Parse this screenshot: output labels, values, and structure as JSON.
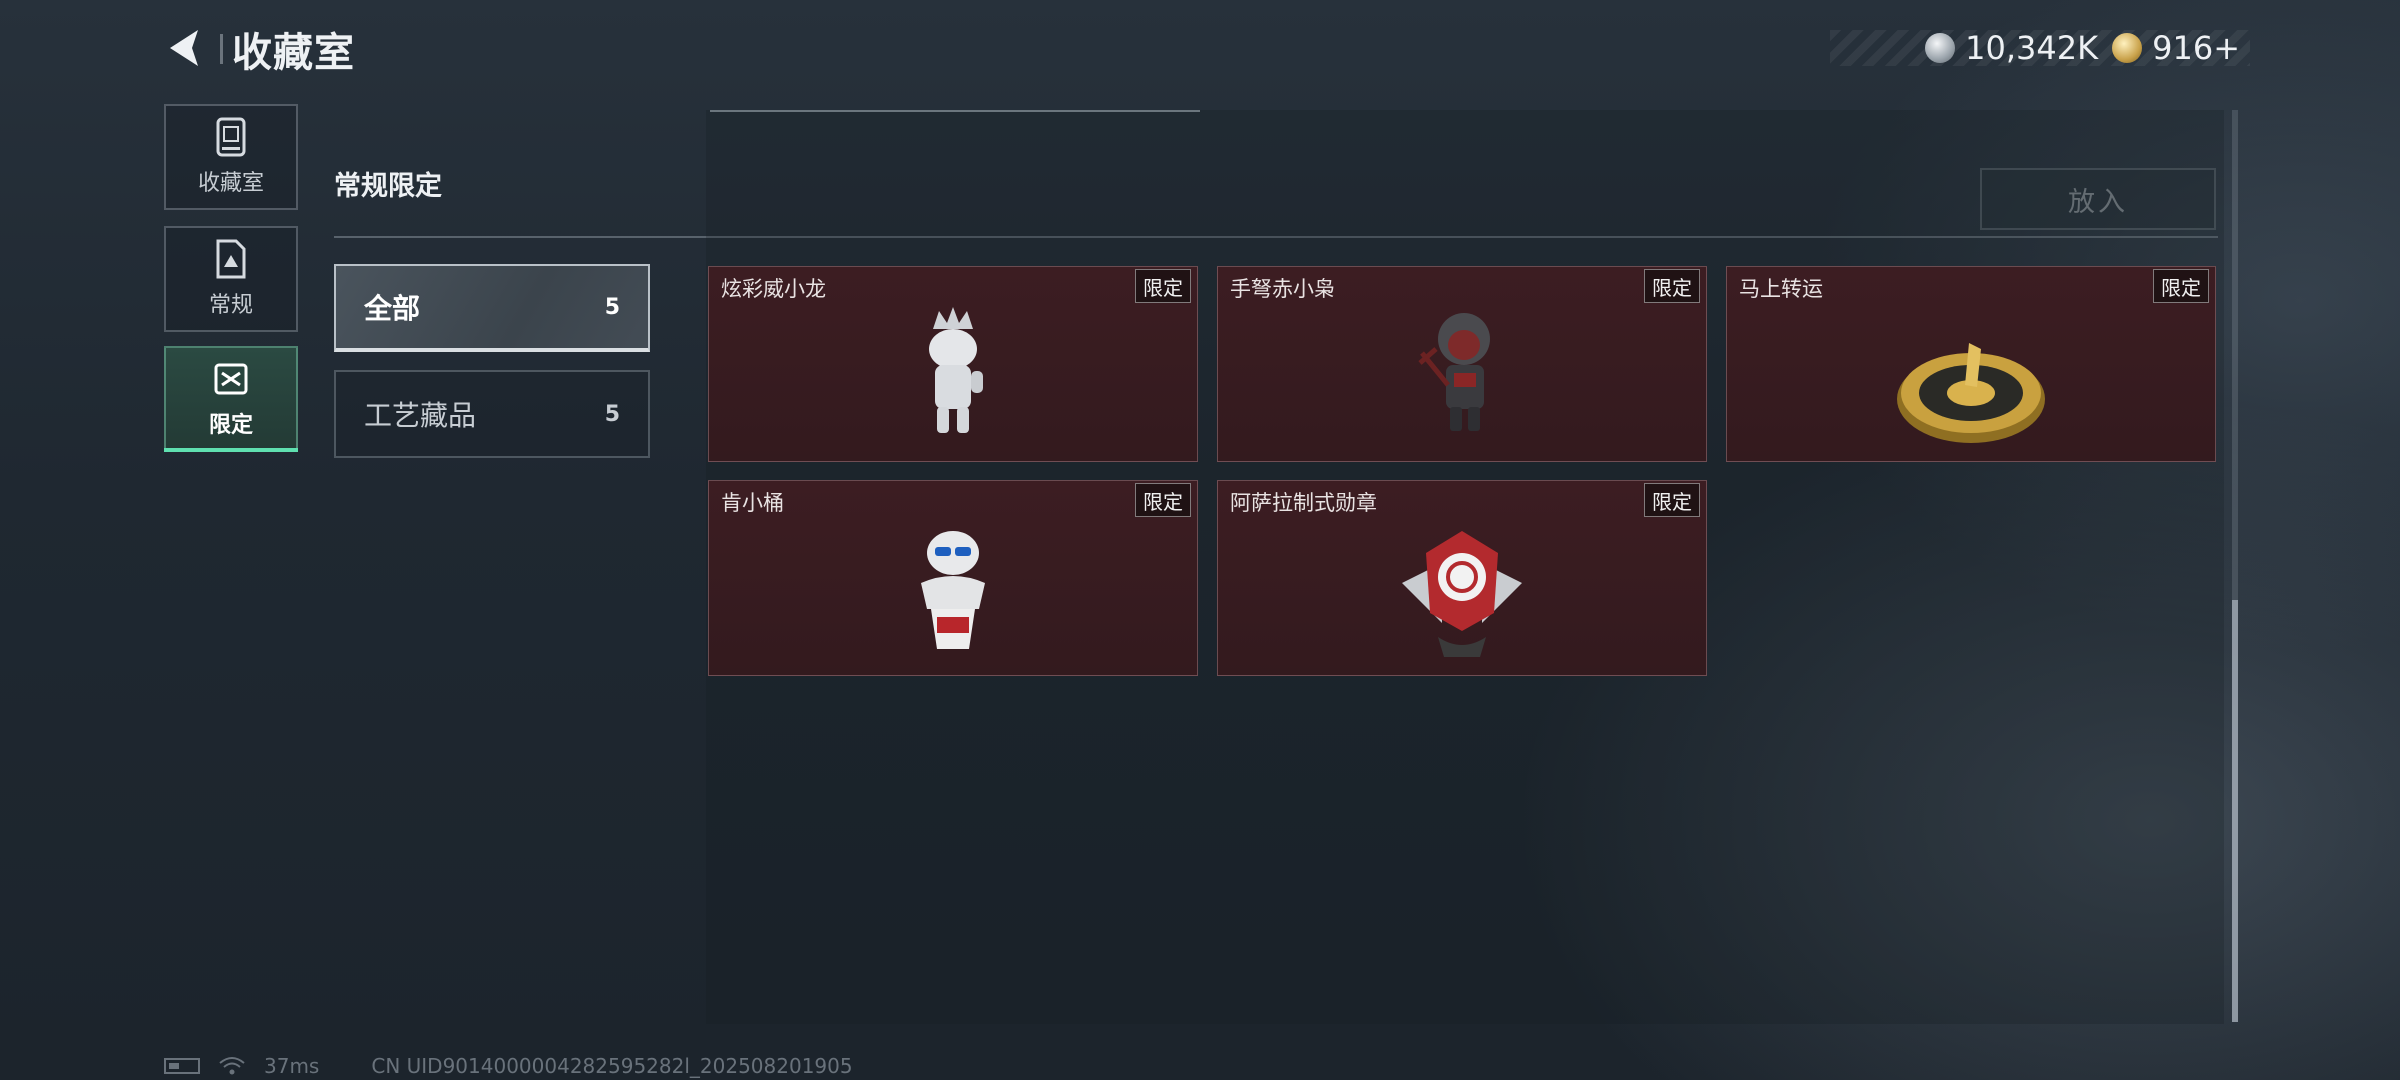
{
  "header": {
    "title": "收藏室",
    "currency": [
      {
        "icon": "silver-coin-icon",
        "value": "10,342K"
      },
      {
        "icon": "gold-coin-icon",
        "value": "916+"
      }
    ]
  },
  "nav": [
    {
      "label": "收藏室",
      "icon": "cabinet-icon"
    },
    {
      "label": "常规",
      "icon": "document-icon"
    },
    {
      "label": "限定",
      "icon": "limited-icon",
      "active": true
    }
  ],
  "section": {
    "title": "常规限定",
    "put_button": "放入"
  },
  "filters": [
    {
      "label": "全部",
      "count": "5",
      "active": true
    },
    {
      "label": "工艺藏品",
      "count": "5"
    }
  ],
  "items": [
    {
      "name": "炫彩威小龙",
      "badge": "限定",
      "art": "white-dragon-figure-icon"
    },
    {
      "name": "手弩赤小枭",
      "badge": "限定",
      "art": "hooded-crossbow-figure-icon"
    },
    {
      "name": "马上转运",
      "badge": "限定",
      "art": "golden-compass-icon"
    },
    {
      "name": "肯小桶",
      "badge": "限定",
      "art": "colonel-bucket-figure-icon"
    },
    {
      "name": "阿萨拉制式勋章",
      "badge": "限定",
      "art": "winged-medal-icon"
    }
  ],
  "status": {
    "ping": "37ms",
    "uid": "CN UID9014000004282595282l_202508201905"
  },
  "colors": {
    "card_bg": "#3c1d22",
    "active_nav": "#2b4a42",
    "accent": "#5fe0b0"
  }
}
